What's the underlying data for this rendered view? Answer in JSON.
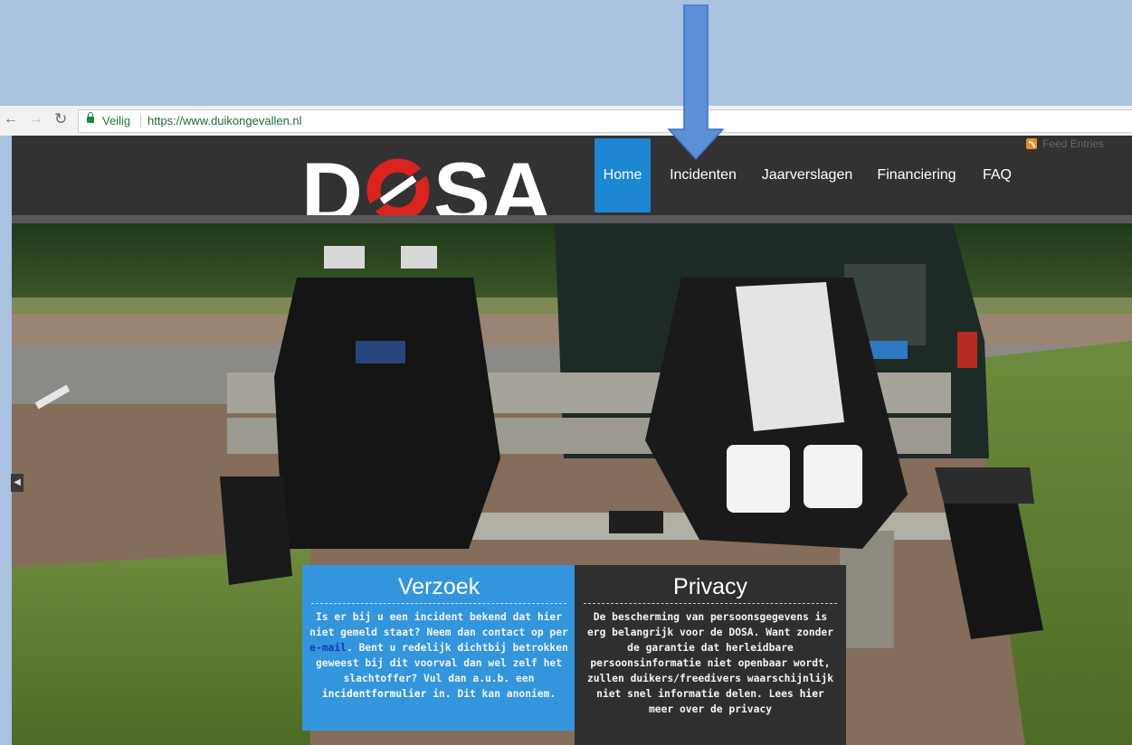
{
  "browser": {
    "back_icon": "arrow-left-icon",
    "forward_icon": "arrow-right-icon",
    "reload_icon": "reload-icon",
    "secure_label": "Veilig",
    "url": "https://www.duikongevallen.nl"
  },
  "site": {
    "logo_text": "DOSA",
    "feed_label": "Feed Entries",
    "nav": [
      {
        "label": "Home",
        "active": true
      },
      {
        "label": "Incidenten",
        "active": false
      },
      {
        "label": "Jaarverslagen",
        "active": false
      },
      {
        "label": "Financiering",
        "active": false
      },
      {
        "label": "FAQ",
        "active": false
      }
    ]
  },
  "boxes": {
    "request": {
      "title": "Verzoek",
      "text_1": "Is er bij u een incident bekend dat hier niet gemeld staat? Neem dan contact op per ",
      "link": "e-mail",
      "text_2": ". Bent u redelijk dichtbij betrokken geweest bij dit voorval dan wel zelf het slachtoffer? Vul dan a.u.b. een ",
      "strong": "incidentformulier",
      "text_3": " in. Dit kan anoniem."
    },
    "privacy": {
      "title": "Privacy",
      "text_1": "De bescherming van persoonsgegevens is erg belangrijk voor de DOSA. Want zonder de garantie dat herleidbare persoonsinformatie niet openbaar wordt, zullen duikers/freedivers waarschijnlijk niet snel informatie delen. Lees ",
      "strong": "hier",
      "text_2": " meer over de privacy"
    }
  },
  "colors": {
    "page_bg": "#a9c2df",
    "header_bg": "#333232",
    "nav_active": "#1d87d4",
    "logo_red": "#d8241c",
    "box_blue": "#3396dd",
    "box_dark": "#2f2f2f",
    "arrow": "#5b8fd9"
  }
}
